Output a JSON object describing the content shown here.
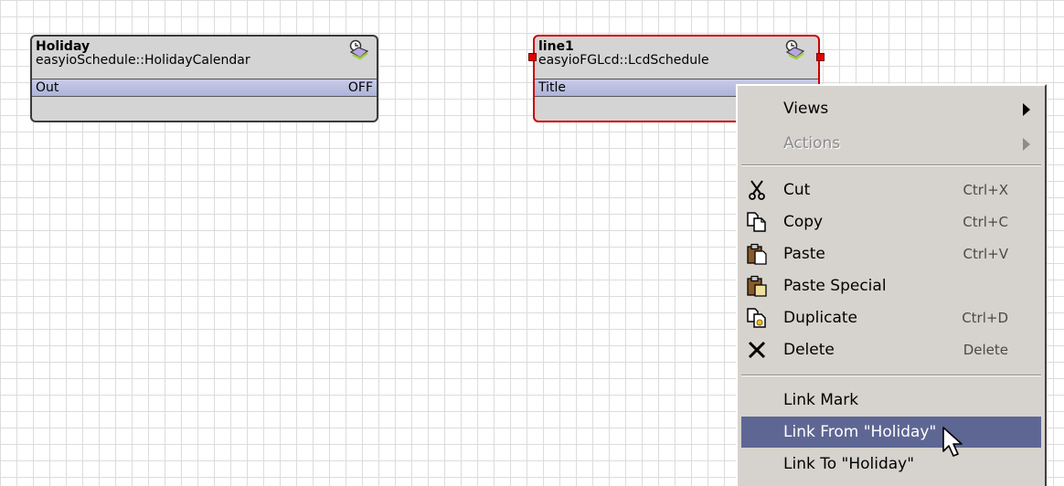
{
  "nodes": {
    "holiday": {
      "name": "Holiday",
      "type": "easyioSchedule::HolidayCalendar",
      "slot_label": "Out",
      "slot_value": "OFF",
      "icon": "schedule-icon"
    },
    "line1": {
      "name": "line1",
      "type": "easyioFGLcd::LcdSchedule",
      "slot_label": "Title",
      "icon": "schedule-icon"
    }
  },
  "context_menu": {
    "views": "Views",
    "actions": "Actions",
    "cut": {
      "label": "Cut",
      "shortcut": "Ctrl+X",
      "icon": "scissors-icon"
    },
    "copy": {
      "label": "Copy",
      "shortcut": "Ctrl+C",
      "icon": "copy-icon"
    },
    "paste": {
      "label": "Paste",
      "shortcut": "Ctrl+V",
      "icon": "clipboard-icon"
    },
    "paste_special": {
      "label": "Paste Special",
      "icon": "clipboard-special-icon"
    },
    "duplicate": {
      "label": "Duplicate",
      "shortcut": "Ctrl+D",
      "icon": "duplicate-icon"
    },
    "delete": {
      "label": "Delete",
      "shortcut": "Delete",
      "icon": "x-icon"
    },
    "link_mark": "Link Mark",
    "link_from": "Link From \"Holiday\"",
    "link_to": "Link To \"Holiday\""
  },
  "colors": {
    "highlight": "#5e6694",
    "selection_border": "#cc0000",
    "slot_fill": "#b4b8dc"
  }
}
